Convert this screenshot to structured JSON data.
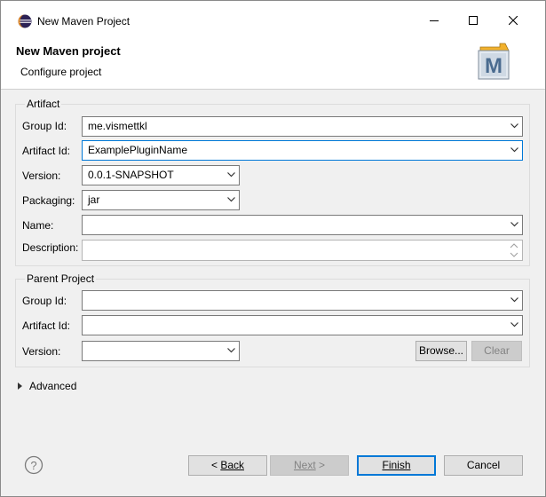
{
  "window": {
    "title": "New Maven Project",
    "icon": "eclipse-icon"
  },
  "banner": {
    "title": "New Maven project",
    "subtitle": "Configure project",
    "logo": "maven-m-logo",
    "logo_letter": "M"
  },
  "artifact": {
    "legend": "Artifact",
    "group_id": {
      "label": "Group Id:",
      "value": "me.vismettkl"
    },
    "artifact_id": {
      "label": "Artifact Id:",
      "value": "ExamplePluginName"
    },
    "version": {
      "label": "Version:",
      "value": "0.0.1-SNAPSHOT"
    },
    "packaging": {
      "label": "Packaging:",
      "value": "jar"
    },
    "name": {
      "label": "Name:",
      "value": ""
    },
    "description": {
      "label": "Description:",
      "value": ""
    }
  },
  "parent": {
    "legend": "Parent Project",
    "group_id": {
      "label": "Group Id:",
      "value": ""
    },
    "artifact_id": {
      "label": "Artifact Id:",
      "value": ""
    },
    "version": {
      "label": "Version:",
      "value": ""
    },
    "browse_label": "Browse...",
    "clear_label": "Clear"
  },
  "advanced": {
    "label": "Advanced"
  },
  "footer": {
    "back_label": "Back",
    "next_label": "Next",
    "finish_label": "Finish",
    "cancel_label": "Cancel"
  },
  "colors": {
    "focus": "#0078d7",
    "background": "#f0f0f0",
    "disabled_text": "#838383"
  }
}
